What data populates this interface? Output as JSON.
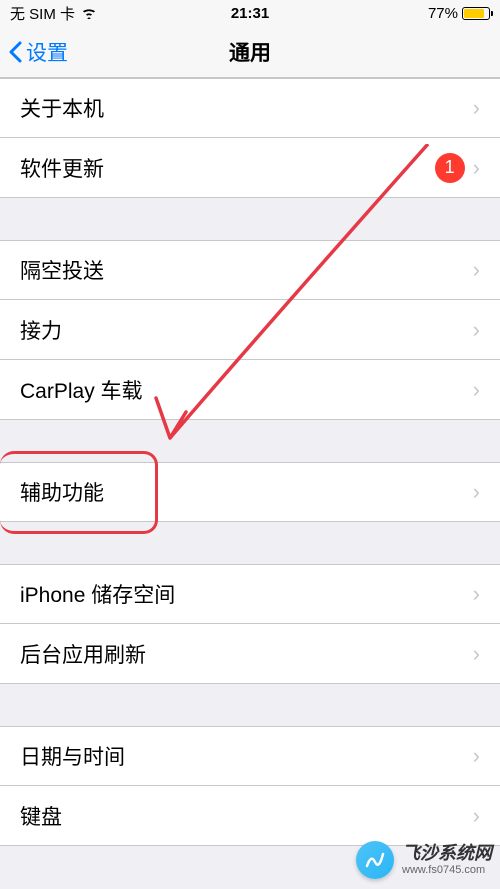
{
  "status": {
    "carrier": "无 SIM 卡",
    "time": "21:31",
    "battery_percent": "77%"
  },
  "nav": {
    "back_label": "设置",
    "title": "通用"
  },
  "rows": {
    "about": "关于本机",
    "software_update": "软件更新",
    "badge_count": "1",
    "airdrop": "隔空投送",
    "handoff": "接力",
    "carplay": "CarPlay 车载",
    "accessibility": "辅助功能",
    "storage": "iPhone 储存空间",
    "background_refresh": "后台应用刷新",
    "date_time": "日期与时间",
    "keyboard": "键盘"
  },
  "watermark": {
    "title": "飞沙系统网",
    "url": "www.fs0745.com"
  }
}
